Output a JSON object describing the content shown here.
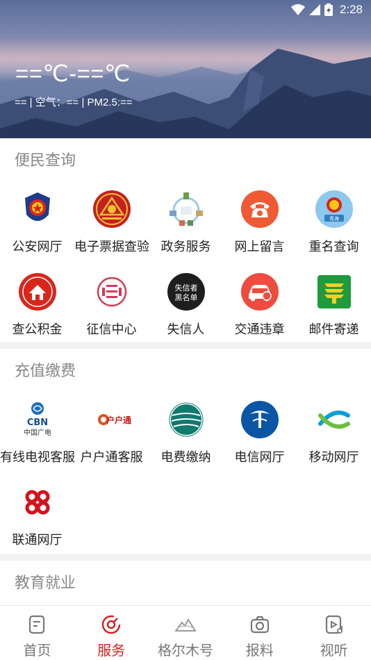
{
  "status_bar": {
    "time": "2:28"
  },
  "weather": {
    "temperature": "==℃-==℃",
    "detail": "== | 空气：== | PM2.5:=="
  },
  "sections": [
    {
      "title": "便民查询",
      "items": [
        {
          "label": "公安网厅",
          "icon": "police-badge-icon"
        },
        {
          "label": "电子票据查验",
          "icon": "receipt-seal-icon"
        },
        {
          "label": "政务服务",
          "icon": "government-service-icon"
        },
        {
          "label": "网上留言",
          "icon": "phone-icon"
        },
        {
          "label": "重名查询",
          "icon": "duplicate-name-icon"
        },
        {
          "label": "查公积金",
          "icon": "housing-fund-icon"
        },
        {
          "label": "征信中心",
          "icon": "credit-center-icon"
        },
        {
          "label": "失信人",
          "icon": "dishonest-list-icon",
          "icon_text": [
            "失信者",
            "黑名单"
          ]
        },
        {
          "label": "交通违章",
          "icon": "traffic-violation-icon"
        },
        {
          "label": "邮件寄递",
          "icon": "post-office-icon"
        }
      ]
    },
    {
      "title": "充值缴费",
      "items": [
        {
          "label": "有线电视客服",
          "icon": "cbn-logo-icon",
          "icon_text": [
            "CBN",
            "中国广电"
          ]
        },
        {
          "label": "户户通客服",
          "icon": "huhutong-logo-icon",
          "icon_text": [
            "户户通"
          ]
        },
        {
          "label": "电费缴纳",
          "icon": "state-grid-icon"
        },
        {
          "label": "电信网厅",
          "icon": "china-telecom-icon"
        },
        {
          "label": "移动网厅",
          "icon": "china-mobile-icon"
        },
        {
          "label": "联通网厅",
          "icon": "china-unicom-icon"
        }
      ]
    },
    {
      "title": "教育就业",
      "items": []
    }
  ],
  "tabbar": [
    {
      "label": "首页",
      "icon": "home-icon",
      "active": false
    },
    {
      "label": "服务",
      "icon": "service-icon",
      "active": true
    },
    {
      "label": "格尔木号",
      "icon": "mountain-icon",
      "active": false
    },
    {
      "label": "报料",
      "icon": "camera-icon",
      "active": false
    },
    {
      "label": "视听",
      "icon": "video-music-icon",
      "active": false
    }
  ],
  "colors": {
    "accent": "#d71e1e",
    "section_title": "#888888",
    "label": "#222222"
  }
}
